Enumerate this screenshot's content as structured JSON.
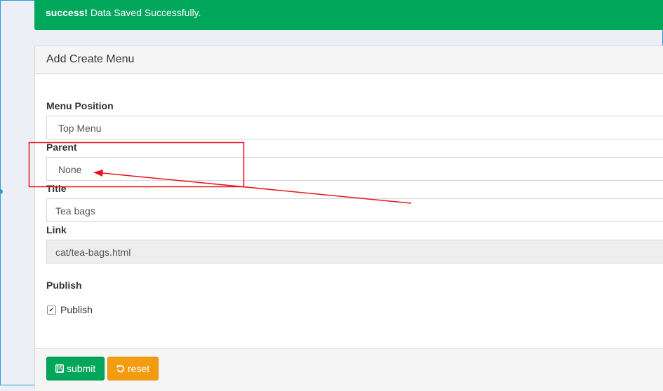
{
  "alert": {
    "strong": "success!",
    "message": " Data Saved Successfully."
  },
  "panel": {
    "title": "Add Create Menu"
  },
  "form": {
    "menu_position": {
      "label": "Menu Position",
      "value": "Top Menu"
    },
    "parent": {
      "label": "Parent",
      "value": "None"
    },
    "title": {
      "label": "Title",
      "value": "Tea bags"
    },
    "link": {
      "label": "Link",
      "value": "cat/tea-bags.html"
    },
    "publish": {
      "label": "Publish",
      "checkbox_label": "Publish",
      "checked": true
    }
  },
  "buttons": {
    "submit": "submit",
    "reset": "reset"
  },
  "icons": {
    "submit": "save-icon",
    "reset": "undo-icon",
    "checkbox": "checkmark-icon"
  },
  "colors": {
    "success": "#00a65a",
    "warning": "#f39c12",
    "annotation": "#e8141a",
    "selection": "#2f9bd6"
  }
}
